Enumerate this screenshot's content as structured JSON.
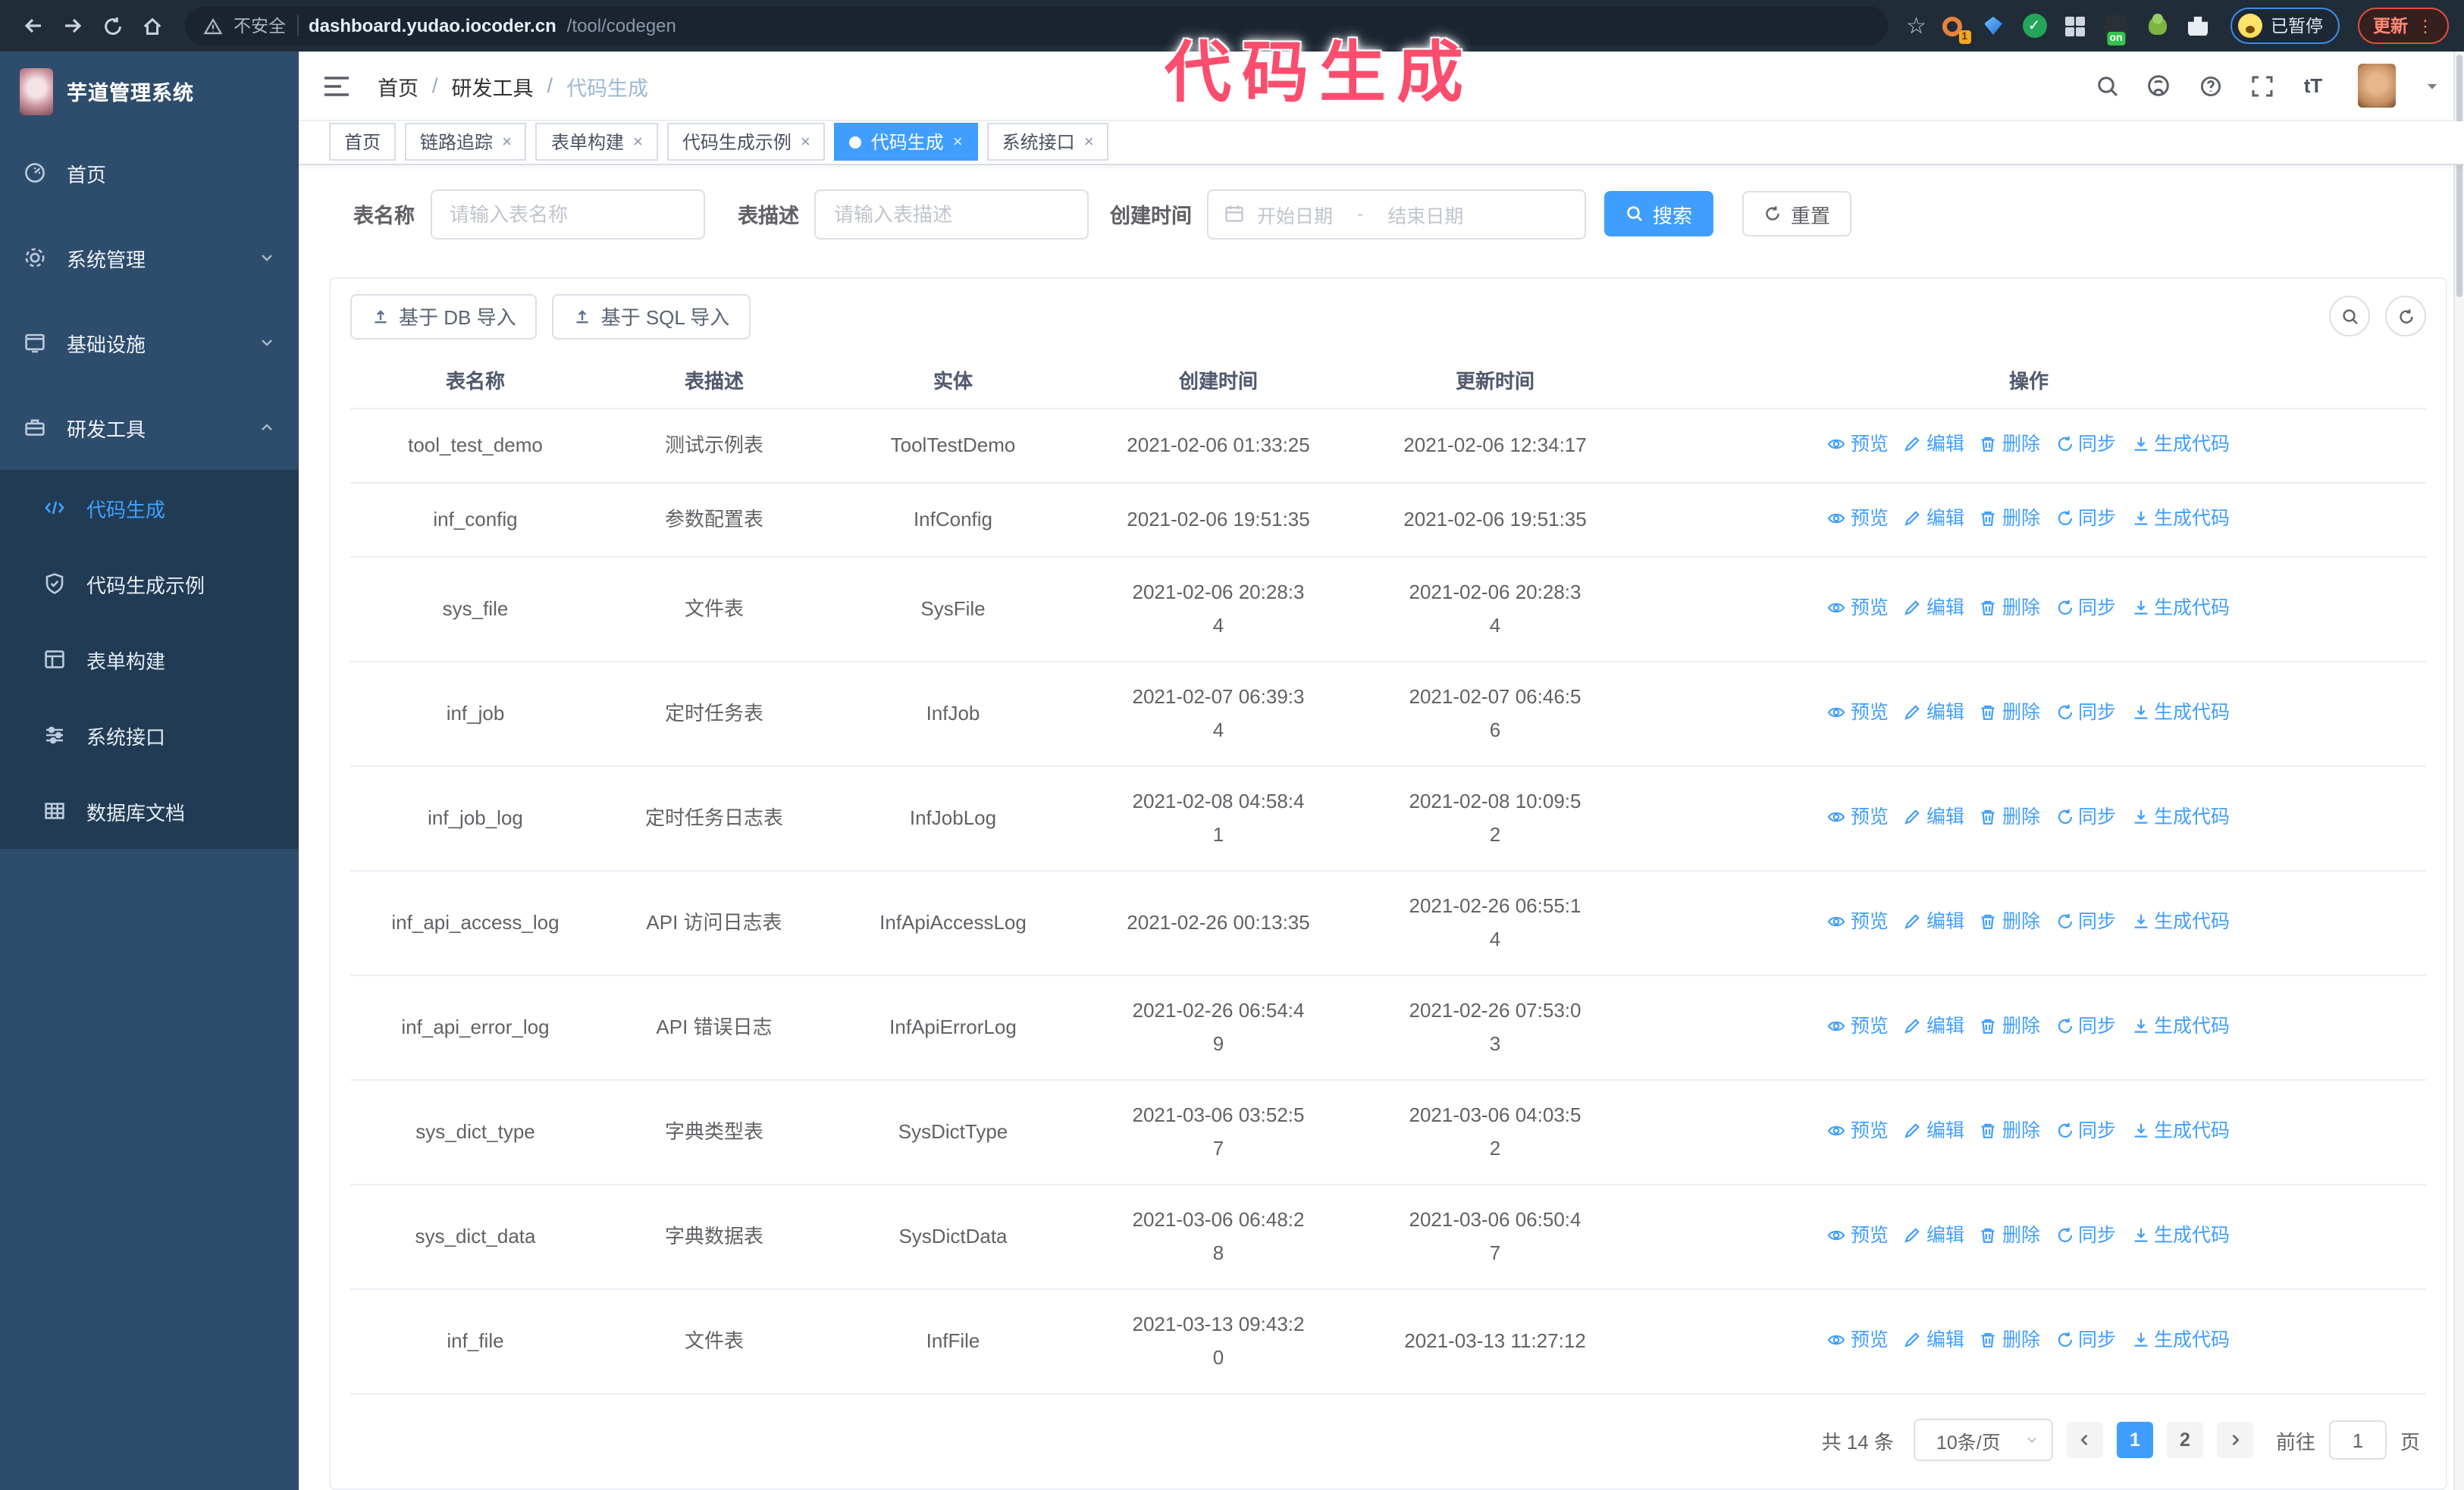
{
  "browser": {
    "security_label": "不安全",
    "url_domain": "dashboard.yudao.iocoder.cn",
    "url_path": "/tool/codegen",
    "extensions": {
      "badge_1": "1",
      "badge_on": "on"
    },
    "paused_badge": "已暂停",
    "update_label": "更新",
    "update_dots": "⋮"
  },
  "overlay_title": "代码生成",
  "sidebar": {
    "app_title": "芋道管理系统",
    "items": [
      {
        "label": "首页",
        "icon": "dashboard-icon"
      },
      {
        "label": "系统管理",
        "icon": "gear-icon"
      },
      {
        "label": "基础设施",
        "icon": "infrastructure-icon"
      },
      {
        "label": "研发工具",
        "icon": "tools-icon"
      }
    ],
    "submenu": [
      {
        "label": "代码生成",
        "icon": "code-icon",
        "active": true
      },
      {
        "label": "代码生成示例",
        "icon": "shield-icon"
      },
      {
        "label": "表单构建",
        "icon": "form-icon"
      },
      {
        "label": "系统接口",
        "icon": "sliders-icon"
      },
      {
        "label": "数据库文档",
        "icon": "database-icon"
      }
    ]
  },
  "breadcrumb": {
    "items": [
      "首页",
      "研发工具",
      "代码生成"
    ],
    "separator": "/"
  },
  "tabs": [
    {
      "label": "首页"
    },
    {
      "label": "链路追踪"
    },
    {
      "label": "表单构建"
    },
    {
      "label": "代码生成示例"
    },
    {
      "label": "代码生成"
    },
    {
      "label": "系统接口"
    }
  ],
  "tab_close": "×",
  "filters": {
    "name_label": "表名称",
    "name_placeholder": "请输入表名称",
    "desc_label": "表描述",
    "desc_placeholder": "请输入表描述",
    "time_label": "创建时间",
    "start_placeholder": "开始日期",
    "range_separator": "-",
    "end_placeholder": "结束日期",
    "search_label": "搜索",
    "reset_label": "重置"
  },
  "toolbar": {
    "import_db": "基于 DB 导入",
    "import_sql": "基于 SQL 导入"
  },
  "table": {
    "headers": [
      "表名称",
      "表描述",
      "实体",
      "创建时间",
      "更新时间",
      "操作"
    ],
    "op_labels": [
      "预览",
      "编辑",
      "删除",
      "同步",
      "生成代码"
    ],
    "rows": [
      {
        "name": "tool_test_demo",
        "desc": "测试示例表",
        "entity": "ToolTestDemo",
        "created": "2021-02-06 01:33:25",
        "updated": "2021-02-06 12:34:17"
      },
      {
        "name": "inf_config",
        "desc": "参数配置表",
        "entity": "InfConfig",
        "created": "2021-02-06 19:51:35",
        "updated": "2021-02-06 19:51:35"
      },
      {
        "name": "sys_file",
        "desc": "文件表",
        "entity": "SysFile",
        "created": "2021-02-06 20:28:3\n4",
        "updated": "2021-02-06 20:28:3\n4"
      },
      {
        "name": "inf_job",
        "desc": "定时任务表",
        "entity": "InfJob",
        "created": "2021-02-07 06:39:3\n4",
        "updated": "2021-02-07 06:46:5\n6"
      },
      {
        "name": "inf_job_log",
        "desc": "定时任务日志表",
        "entity": "InfJobLog",
        "created": "2021-02-08 04:58:4\n1",
        "updated": "2021-02-08 10:09:5\n2"
      },
      {
        "name": "inf_api_access_log",
        "desc": "API 访问日志表",
        "entity": "InfApiAccessLog",
        "created": "2021-02-26 00:13:35",
        "updated": "2021-02-26 06:55:1\n4"
      },
      {
        "name": "inf_api_error_log",
        "desc": "API 错误日志",
        "entity": "InfApiErrorLog",
        "created": "2021-02-26 06:54:4\n9",
        "updated": "2021-02-26 07:53:0\n3"
      },
      {
        "name": "sys_dict_type",
        "desc": "字典类型表",
        "entity": "SysDictType",
        "created": "2021-03-06 03:52:5\n7",
        "updated": "2021-03-06 04:03:5\n2"
      },
      {
        "name": "sys_dict_data",
        "desc": "字典数据表",
        "entity": "SysDictData",
        "created": "2021-03-06 06:48:2\n8",
        "updated": "2021-03-06 06:50:4\n7"
      },
      {
        "name": "inf_file",
        "desc": "文件表",
        "entity": "InfFile",
        "created": "2021-03-13 09:43:2\n0",
        "updated": "2021-03-13 11:27:12"
      }
    ]
  },
  "pagination": {
    "total": "共 14 条",
    "page_size": "10条/页",
    "pages": [
      "1",
      "2"
    ],
    "active_page": "1",
    "goto_label": "前往",
    "goto_value": "1",
    "page_unit": "页"
  },
  "colors": {
    "accent": "#409eff",
    "overlay_pink": "#fb4d6d",
    "sidebar_bg": "#2e4c6c",
    "submenu_bg": "#223b55",
    "browser_bar_bg": "#212c39"
  }
}
